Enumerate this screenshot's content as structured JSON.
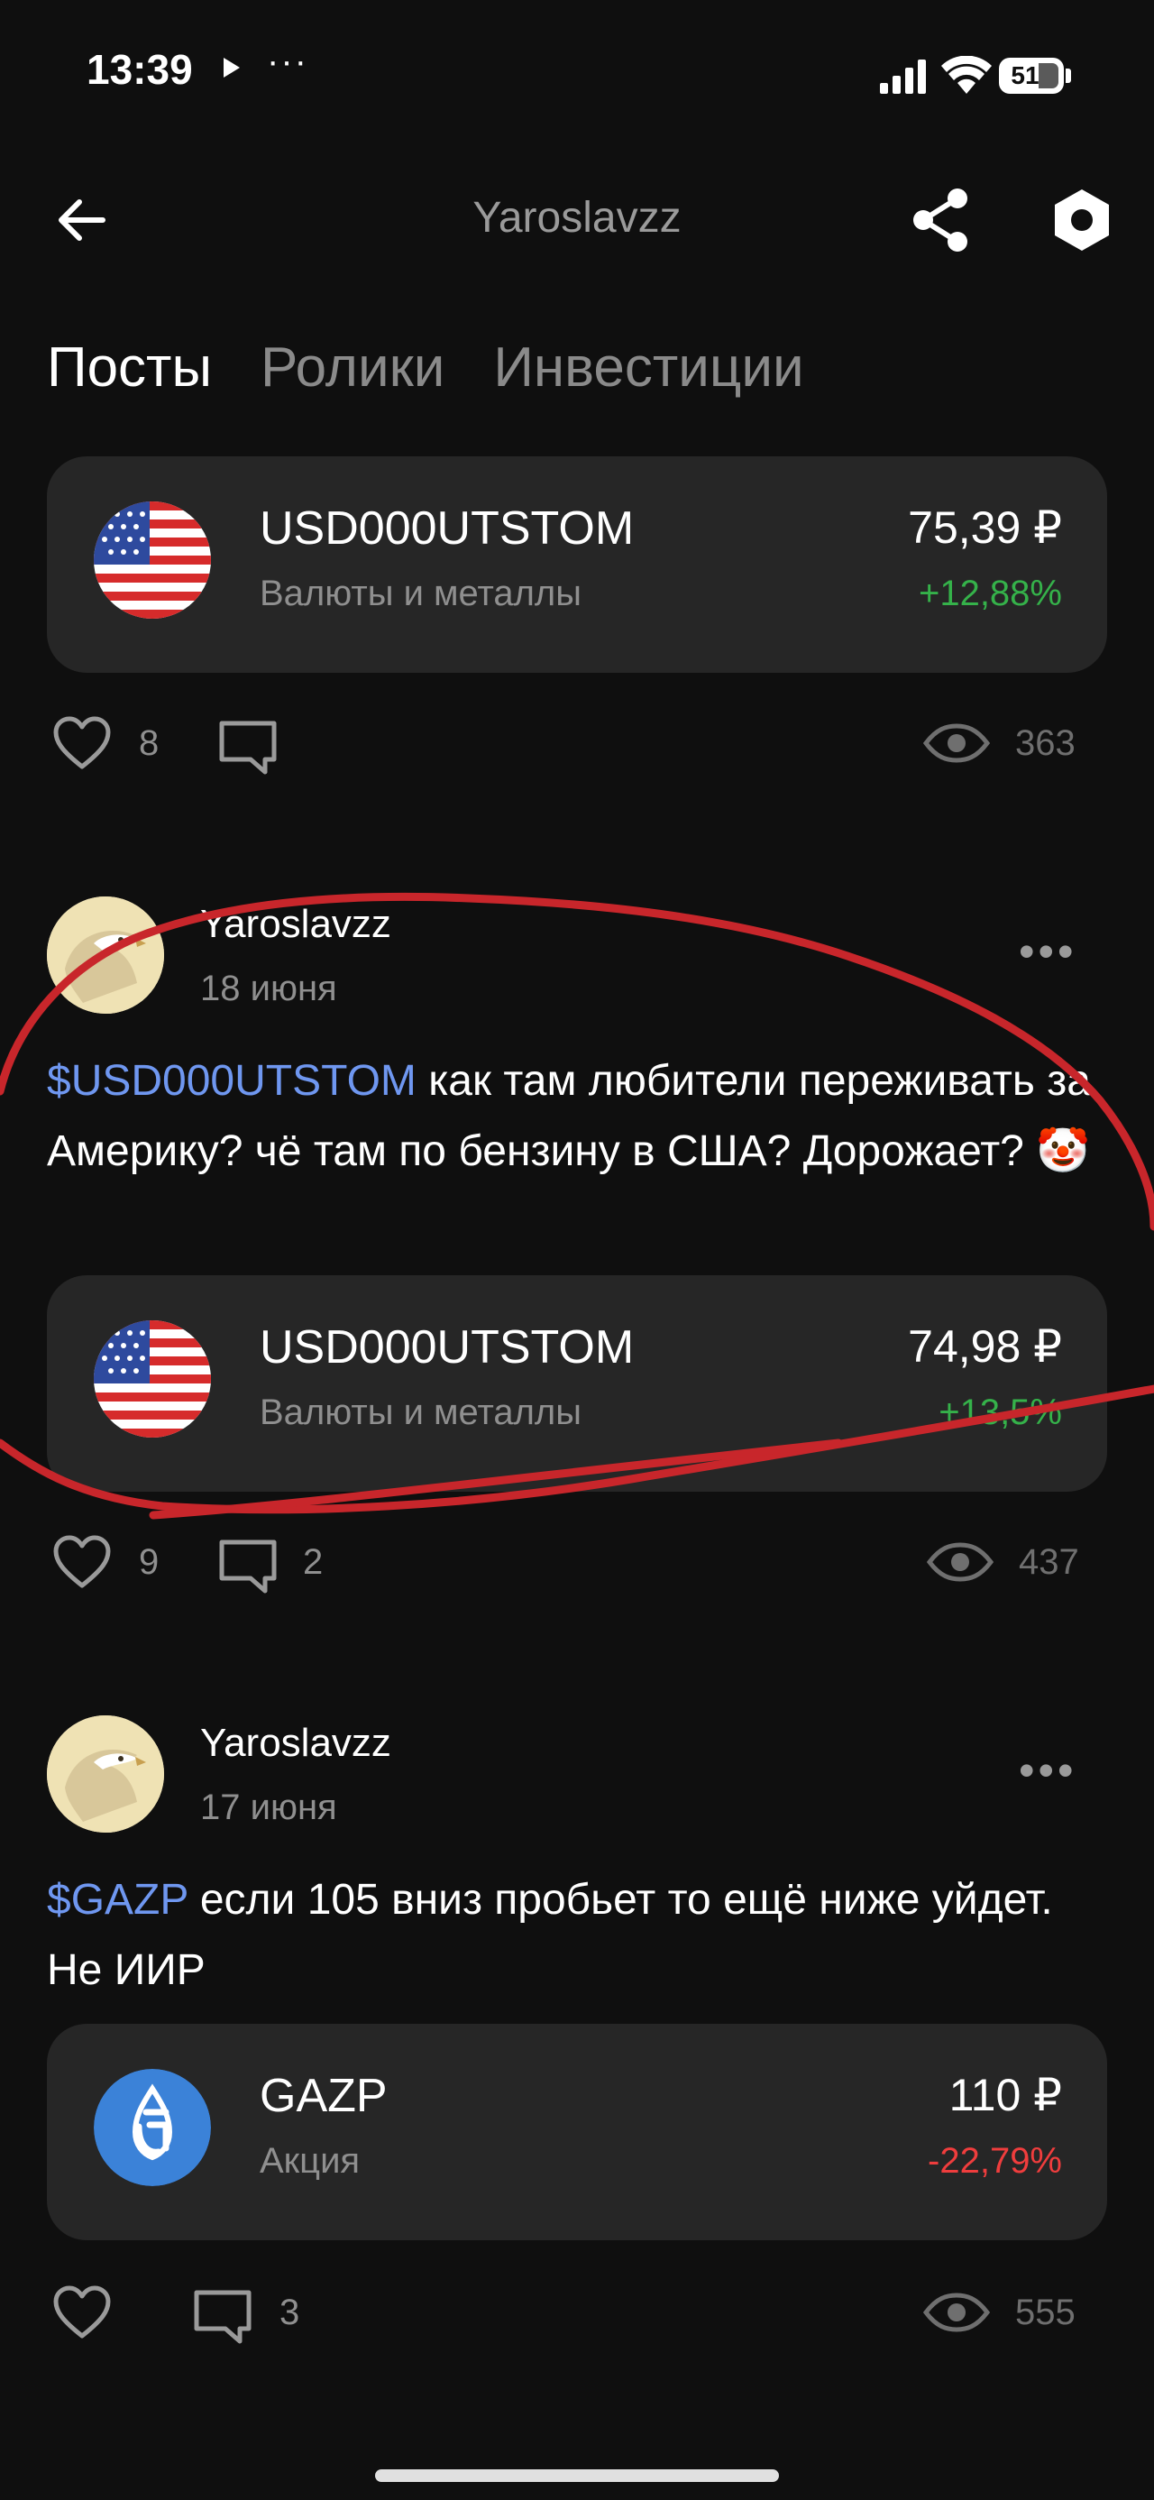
{
  "status_bar": {
    "time": "13:39",
    "dots": "···",
    "battery": "51"
  },
  "header": {
    "title": "Yaroslavzz"
  },
  "tabs": [
    {
      "label": "Посты",
      "active": true
    },
    {
      "label": "Ролики",
      "active": false
    },
    {
      "label": "Инвестиции",
      "active": false
    }
  ],
  "top_card": {
    "ticker": "USD000UTSTOM",
    "type": "Валюты и металлы",
    "price": "75,39 ₽",
    "change": "+12,88%",
    "likes": "8",
    "comments": "",
    "views": "363"
  },
  "posts": [
    {
      "author": "Yaroslavzz",
      "date": "18 июня",
      "tag": "$USD000UTSTOM",
      "text_after_tag": " как там любители переживать за Америку? чё там по бензину в США? Дорожает? ",
      "emoji": "🤡",
      "card": {
        "ticker": "USD000UTSTOM",
        "type": "Валюты и металлы",
        "price": "74,98 ₽",
        "change": "+13,5%"
      },
      "likes": "9",
      "comments": "2",
      "views": "437"
    },
    {
      "author": "Yaroslavzz",
      "date": "17 июня",
      "tag": "$GAZP",
      "text_after_tag": " если 105 вниз пробьет то ещё ниже уйдет. Не ИИР",
      "card": {
        "ticker": "GAZP",
        "type": "Акция",
        "price": "110 ₽",
        "change": "-22,79%"
      },
      "likes": "",
      "comments": "3",
      "views": "555"
    }
  ],
  "colors": {
    "background": "#0f0f0f",
    "card": "#262626",
    "positive": "#35b24a",
    "negative": "#ef3d3d",
    "tag": "#6f97f0",
    "annotation": "#c8262b"
  },
  "icons": [
    "back-arrow-icon",
    "share-icon",
    "settings-icon",
    "heart-icon",
    "comment-icon",
    "eye-icon",
    "more-icon",
    "us-flag-icon",
    "gazprom-logo-icon",
    "clown-emoji"
  ]
}
